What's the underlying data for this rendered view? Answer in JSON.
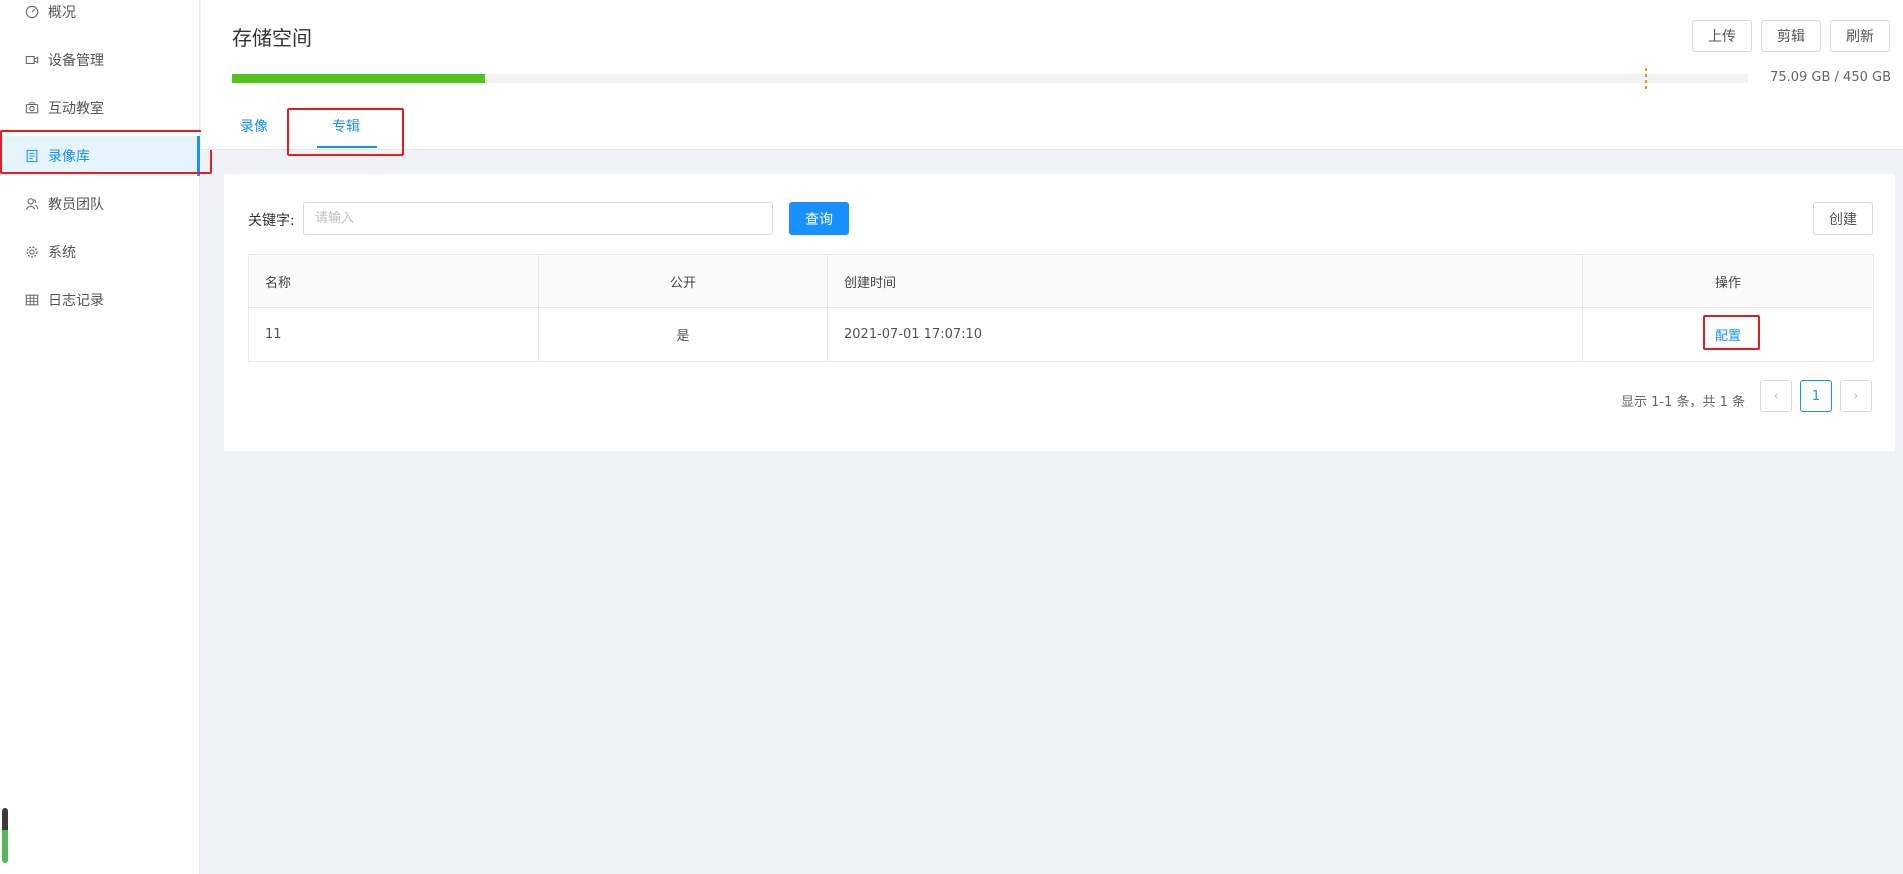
{
  "sidebar": {
    "items": [
      {
        "label": "概况",
        "icon": "dashboard-icon"
      },
      {
        "label": "设备管理",
        "icon": "camera-icon"
      },
      {
        "label": "互动教室",
        "icon": "photo-camera-icon"
      },
      {
        "label": "录像库",
        "icon": "book-icon"
      },
      {
        "label": "教员团队",
        "icon": "team-icon"
      },
      {
        "label": "系统",
        "icon": "gear-icon"
      },
      {
        "label": "日志记录",
        "icon": "table-icon"
      }
    ],
    "active_index": 3
  },
  "header": {
    "title": "存储空间",
    "buttons": {
      "upload": "上传",
      "edit": "剪辑",
      "refresh": "刷新"
    },
    "storage": {
      "used_text": "75.09 GB / 450 GB",
      "used_fraction": 0.1669
    }
  },
  "tabs": [
    {
      "label": "录像"
    },
    {
      "label": "专辑"
    }
  ],
  "active_tab": 1,
  "filter": {
    "keyword_label": "关键字:",
    "keyword_placeholder": "请输入",
    "keyword_value": "",
    "query_label": "查询",
    "create_label": "创建"
  },
  "table": {
    "columns": [
      "名称",
      "公开",
      "创建时间",
      "操作"
    ],
    "rows": [
      {
        "name": "11",
        "public": "是",
        "created": "2021-07-01 17:07:10",
        "action": "配置"
      }
    ]
  },
  "pagination": {
    "summary": "显示 1-1 条，共 1 条",
    "current_page": "1",
    "prev": "‹",
    "next": "›"
  },
  "colors": {
    "accent": "#1890ff",
    "progress": "#52c41a",
    "highlight": "#e02020"
  }
}
